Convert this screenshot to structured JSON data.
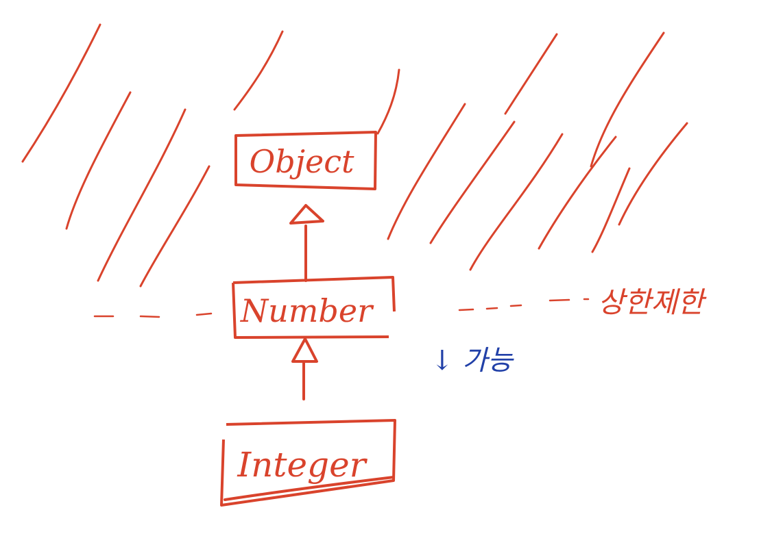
{
  "diagram": {
    "nodes": [
      {
        "id": "object",
        "label": "Object"
      },
      {
        "id": "number",
        "label": "Number"
      },
      {
        "id": "integer",
        "label": "Integer"
      }
    ],
    "edges": [
      {
        "from": "number",
        "to": "object",
        "kind": "inheritance-arrow"
      },
      {
        "from": "integer",
        "to": "number",
        "kind": "inheritance-arrow"
      }
    ],
    "annotations": {
      "upper_bound_label": "상한제한",
      "allowed_label": "↓ 가능"
    },
    "colors": {
      "ink_red": "#d9432c",
      "ink_blue": "#2140a8",
      "paper": "#ffffff"
    }
  }
}
